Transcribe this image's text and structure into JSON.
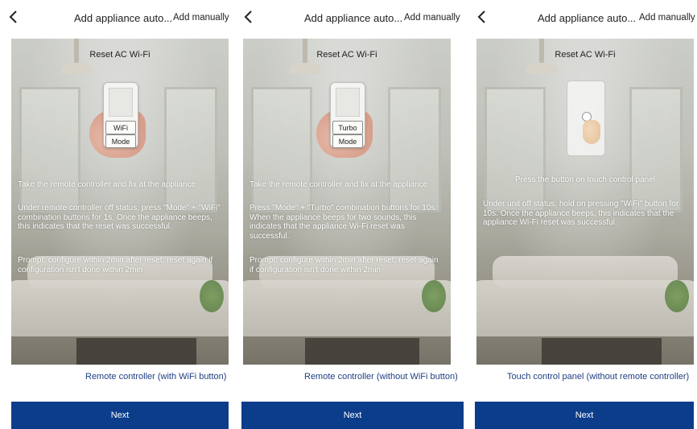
{
  "panels": [
    {
      "header": {
        "title": "Add appliance auto...",
        "add_manually": "Add manually"
      },
      "reset_title": "Reset AC Wi-Fi",
      "remote_buttons": [
        "WiFi",
        "Mode"
      ],
      "instruction_title": "Take the remote controller and fix at the appliance",
      "instruction_body": "Under remote controller off status, press \"Mode\" + \"WiFi\" combination buttons for 1s. Once the appliance beeps, this indicates that the reset was successful.",
      "prompt": "Prompt: configure within 2min after reset; reset again if configuration isn't done within 2min",
      "mode_label": "Remote controller (with WiFi button)",
      "next_label": "Next"
    },
    {
      "header": {
        "title": "Add appliance auto...",
        "add_manually": "Add manually"
      },
      "reset_title": "Reset AC Wi-Fi",
      "remote_buttons": [
        "Turbo",
        "Mode"
      ],
      "instruction_title": "Take the remote controller and fix at the appliance",
      "instruction_body": "Press \"Mode\" + \"Turbo\" combination buttons for 10s. When the appliance beeps for two sounds, this indicates that the appliance Wi-Fi reset was successful.",
      "prompt": "Prompt: configure within 2min after reset; reset again if configuration isn't done within 2min",
      "mode_label": "Remote controller (without WiFi button)",
      "next_label": "Next"
    },
    {
      "header": {
        "title": "Add appliance auto...",
        "add_manually": "Add manually"
      },
      "reset_title": "Reset AC Wi-Fi",
      "instruction_title": "Press the button on touch control panel",
      "instruction_body": "Under unit off status, hold on pressing \"WiFi\" button for 10s. Once the appliance beeps, this indicates that the appliance Wi-Fi reset was successful.",
      "mode_label": "Touch control panel (without remote controller)",
      "next_label": "Next"
    }
  ],
  "colors": {
    "accent": "#0b3d8a",
    "link": "#1f3f82",
    "text": "#222222"
  },
  "icons": {
    "back": "chevron-left-icon",
    "hand": "hand-icon",
    "finger": "finger-tap-icon"
  }
}
